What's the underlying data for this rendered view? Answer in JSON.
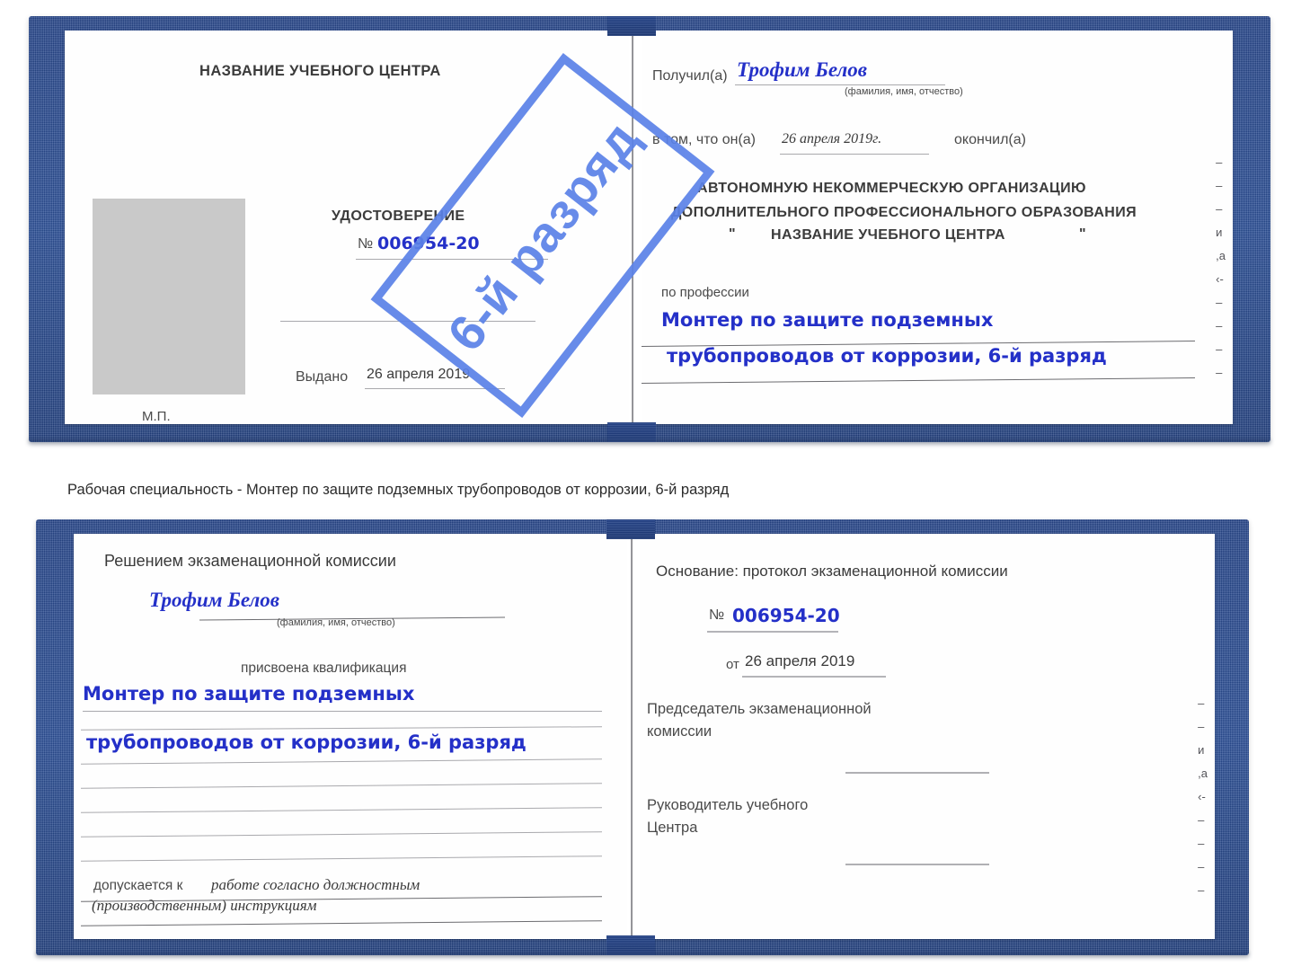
{
  "caption": {
    "text": "Рабочая специальность - Монтер по защите подземных трубопроводов от коррозии, 6-й разряд"
  },
  "colors": {
    "cover_blue": "#27468a",
    "stamp_blue": "#5b82e8",
    "ink_blue": "#2430c8",
    "rule_gray": "#a9a9ad",
    "photo_gray": "#c9c9c9"
  },
  "stamp": {
    "text": "6-й разряд"
  },
  "certificate_top": {
    "left_page": {
      "center_title": "НАЗВАНИЕ УЧЕБНОГО ЦЕНТРА",
      "doc_type": "УДОСТОВЕРЕНИЕ",
      "number_label": "№",
      "number_value": "006954-20",
      "issued_label": "Выдано",
      "issued_value": "26 апреля 2019",
      "seal_label": "М.П."
    },
    "right_page": {
      "received_label": "Получил(а)",
      "received_value": "Трофим Белов",
      "name_hint": "(фамилия, имя, отчество)",
      "that_he_label": "в том, что он(а)",
      "completion_date": "26 апреля 2019г.",
      "finished_label": "окончил(а)",
      "org_line1": "АВТОНОМНУЮ НЕКОММЕРЧЕСКУЮ ОРГАНИЗАЦИЮ",
      "org_line2": "ДОПОЛНИТЕЛЬНОГО ПРОФЕССИОНАЛЬНОГО ОБРАЗОВАНИЯ",
      "org_quote_open": "\"",
      "org_name": "НАЗВАНИЕ УЧЕБНОГО ЦЕНТРА",
      "org_quote_close": "\"",
      "profession_label": "по профессии",
      "profession_line1": "Монтер по защите подземных",
      "profession_line2": "трубопроводов от коррозии, 6-й разряд"
    },
    "edge_column": [
      "–",
      "–",
      "–",
      "и",
      ",а",
      "‹-",
      "–",
      "–",
      "–",
      "–"
    ]
  },
  "certificate_bottom": {
    "left_page": {
      "heading": "Решением экзаменационной комиссии",
      "name_value": "Трофим Белов",
      "name_hint": "(фамилия, имя, отчество)",
      "qualification_label": "присвоена квалификация",
      "qualification_line1": "Монтер по защите подземных",
      "qualification_line2": "трубопроводов от коррозии, 6-й разряд",
      "admitted_label": "допускается к",
      "admitted_value_line1": "работе согласно должностным",
      "admitted_value_line2": "(производственным) инструкциям"
    },
    "right_page": {
      "basis_label": "Основание: протокол экзаменационной комиссии",
      "number_label": "№",
      "number_value": "006954-20",
      "date_label": "от",
      "date_value": "26 апреля 2019",
      "chairman_line1": "Председатель экзаменационной",
      "chairman_line2": "комиссии",
      "head_line1": "Руководитель учебного",
      "head_line2": "Центра"
    },
    "edge_column": [
      "–",
      "–",
      "и",
      ",а",
      "‹-",
      "–",
      "–",
      "–",
      "–"
    ]
  }
}
